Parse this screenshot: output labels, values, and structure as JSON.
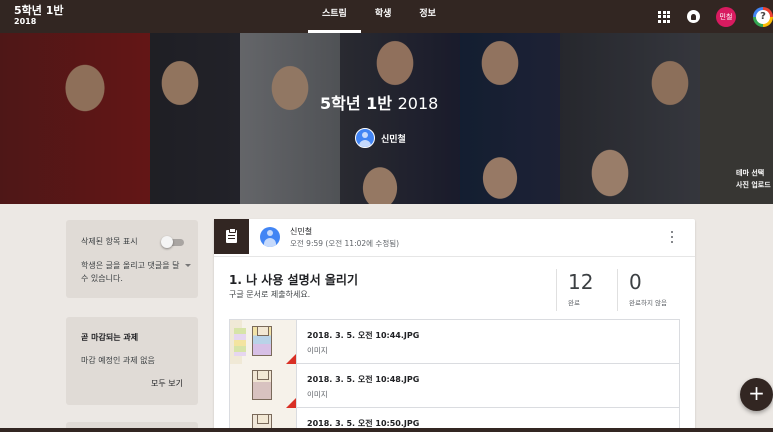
{
  "class": {
    "name": "5학년 1반",
    "year": "2018"
  },
  "tabs": [
    {
      "label": "스트림",
      "active": true
    },
    {
      "label": "학생",
      "active": false
    },
    {
      "label": "정보",
      "active": false
    }
  ],
  "user": {
    "avatar_text": "민철"
  },
  "banner": {
    "title_main": "5학년 1반",
    "title_year": "2018",
    "teacher_name": "신민철",
    "theme_select": "테마 선택",
    "photo_upload": "사진 업로드"
  },
  "sidebar": {
    "deleted_toggle_label": "삭제된 항목 표시",
    "deleted_toggle_on": false,
    "permission_text": "학생은 글을 올리고 댓글을 달 수 있습니다.",
    "due_title": "곧 마감되는 과제",
    "due_none": "마감 예정인 과제 없음",
    "see_all": "모두 보기"
  },
  "post": {
    "author": "신민철",
    "time": "오전 9:59 (오전 11:02에 수정됨)",
    "title": "1. 나 사용 설명서 올리기",
    "description": "구글 문서로 제출하세요.",
    "done_count": "12",
    "done_label": "완료",
    "not_done_count": "0",
    "not_done_label": "완료하지 않음",
    "attachments": [
      {
        "name": "2018. 3. 5. 오전 10:44.JPG",
        "type": "이미지"
      },
      {
        "name": "2018. 3. 5. 오전 10:48.JPG",
        "type": "이미지"
      },
      {
        "name": "2018. 3. 5. 오전 10:50.JPG",
        "type": "이미지"
      }
    ]
  },
  "fab": {
    "label": "+"
  },
  "colors": {
    "theme": "#322622",
    "avatar_top": "#d81b60",
    "avatar_blue": "#4285f4",
    "attachment_flag": "#d93025"
  }
}
